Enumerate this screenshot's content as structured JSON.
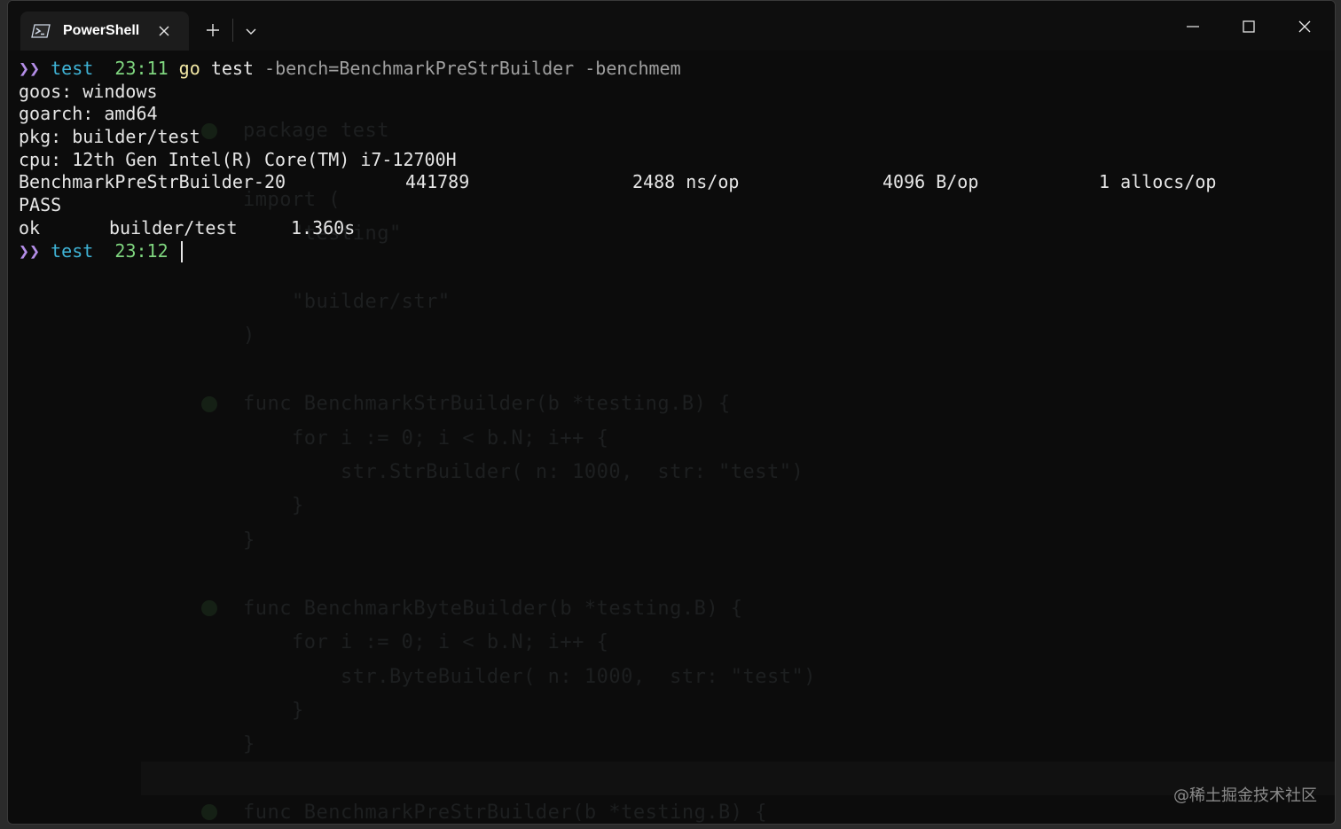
{
  "tab": {
    "title": "PowerShell",
    "icon": "powershell-icon"
  },
  "titlebar": {
    "new_tab_glyph": "+",
    "dropdown_glyph": "⌄",
    "minimize_glyph": "—",
    "maximize_glyph": "☐",
    "close_glyph": "✕"
  },
  "terminal": {
    "prompt_chevron": "❯❯",
    "line1": {
      "dir": "test",
      "time": "23:11",
      "cmd": "go",
      "sub": "test",
      "args": "-bench=BenchmarkPreStrBuilder -benchmem"
    },
    "output": [
      "goos: windows",
      "goarch: amd64",
      "pkg: builder/test",
      "cpu: 12th Gen Intel(R) Core(TM) i7-12700H"
    ],
    "bench_row": {
      "name": "BenchmarkPreStrBuilder-20",
      "iterations": "441789",
      "ns_op": "2488 ns/op",
      "b_op": "4096 B/op",
      "allocs_op": "1 allocs/op"
    },
    "pass": "PASS",
    "ok_row": {
      "status": "ok",
      "pkg": "builder/test",
      "time": "1.360s"
    },
    "line2": {
      "dir": "test",
      "time": "23:12"
    }
  },
  "background_code": [
    "package test",
    "import (",
    "    \"testing\"",
    "    \"builder/str\"",
    ")",
    "func BenchmarkStrBuilder(b *testing.B) {",
    "    for i := 0; i < b.N; i++ {",
    "        str.StrBuilder( n: 1000,  str: \"test\")",
    "    }",
    "}",
    "func BenchmarkByteBuilder(b *testing.B) {",
    "    for i := 0; i < b.N; i++ {",
    "        str.ByteBuilder( n: 1000,  str: \"test\")",
    "    }",
    "}",
    "func BenchmarkPreStrBuilder(b *testing.B) {"
  ],
  "watermark": "@稀土掘金技术社区",
  "colors": {
    "background": "#0c0c0c",
    "prompt_chevron": "#b48ee8",
    "prompt_dir": "#3fb3d6",
    "prompt_time": "#7fd67f",
    "command": "#f2e7a4",
    "text": "#e6e6e6"
  }
}
